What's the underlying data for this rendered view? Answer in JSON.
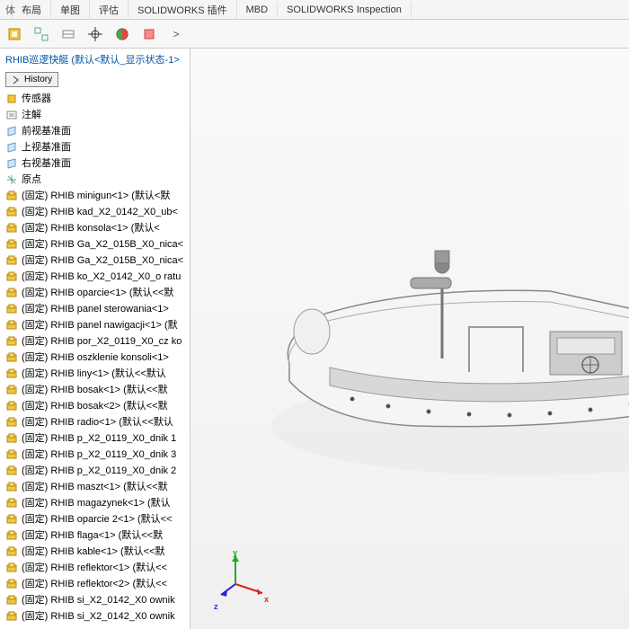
{
  "top_tabs": [
    "布局",
    "单图",
    "评估",
    "SOLIDWORKS 插件",
    "MBD",
    "SOLIDWORKS Inspection"
  ],
  "toolbar_expand": ">",
  "root": "RHIB巡逻快艇 (默认<默认_显示状态-1>",
  "history_label": "History",
  "basic_nodes": [
    {
      "icon": "sensor",
      "label": "传感器"
    },
    {
      "icon": "note",
      "label": "注解"
    },
    {
      "icon": "plane",
      "label": "前视基准面"
    },
    {
      "icon": "plane",
      "label": "上视基准面"
    },
    {
      "icon": "plane",
      "label": "右视基准面"
    },
    {
      "icon": "origin",
      "label": "原点"
    }
  ],
  "comp_nodes": [
    "(固定) RHIB minigun<1> (默认<默",
    "(固定) RHIB kad_X2_0142_X0_ub<",
    "(固定) RHIB konsola<1> (默认<",
    "(固定) RHIB Ga_X2_015B_X0_nica<",
    "(固定) RHIB Ga_X2_015B_X0_nica<",
    "(固定) RHIB ko_X2_0142_X0_o ratu",
    "(固定) RHIB oparcie<1> (默认<<默",
    "(固定) RHIB panel sterowania<1>",
    "(固定) RHIB panel nawigacji<1> (默",
    "(固定) RHIB por_X2_0119_X0_cz ko",
    "(固定) RHIB oszklenie konsoli<1>",
    "(固定) RHIB liny<1> (默认<<默认",
    "(固定) RHIB bosak<1> (默认<<默",
    "(固定) RHIB bosak<2> (默认<<默",
    "(固定) RHIB radio<1> (默认<<默认",
    "(固定) RHIB p_X2_0119_X0_dnik 1",
    "(固定) RHIB p_X2_0119_X0_dnik 3",
    "(固定) RHIB p_X2_0119_X0_dnik 2",
    "(固定) RHIB maszt<1> (默认<<默",
    "(固定) RHIB magazynek<1> (默认",
    "(固定) RHIB oparcie 2<1> (默认<<",
    "(固定) RHIB flaga<1> (默认<<默",
    "(固定) RHIB kable<1> (默认<<默",
    "(固定) RHIB reflektor<1> (默认<<",
    "(固定) RHIB reflektor<2> (默认<<",
    "(固定) RHIB si_X2_0142_X0 ownik",
    "(固定) RHIB si_X2_0142_X0 ownik"
  ],
  "axes": {
    "x": "x",
    "y": "y",
    "z": "z"
  }
}
